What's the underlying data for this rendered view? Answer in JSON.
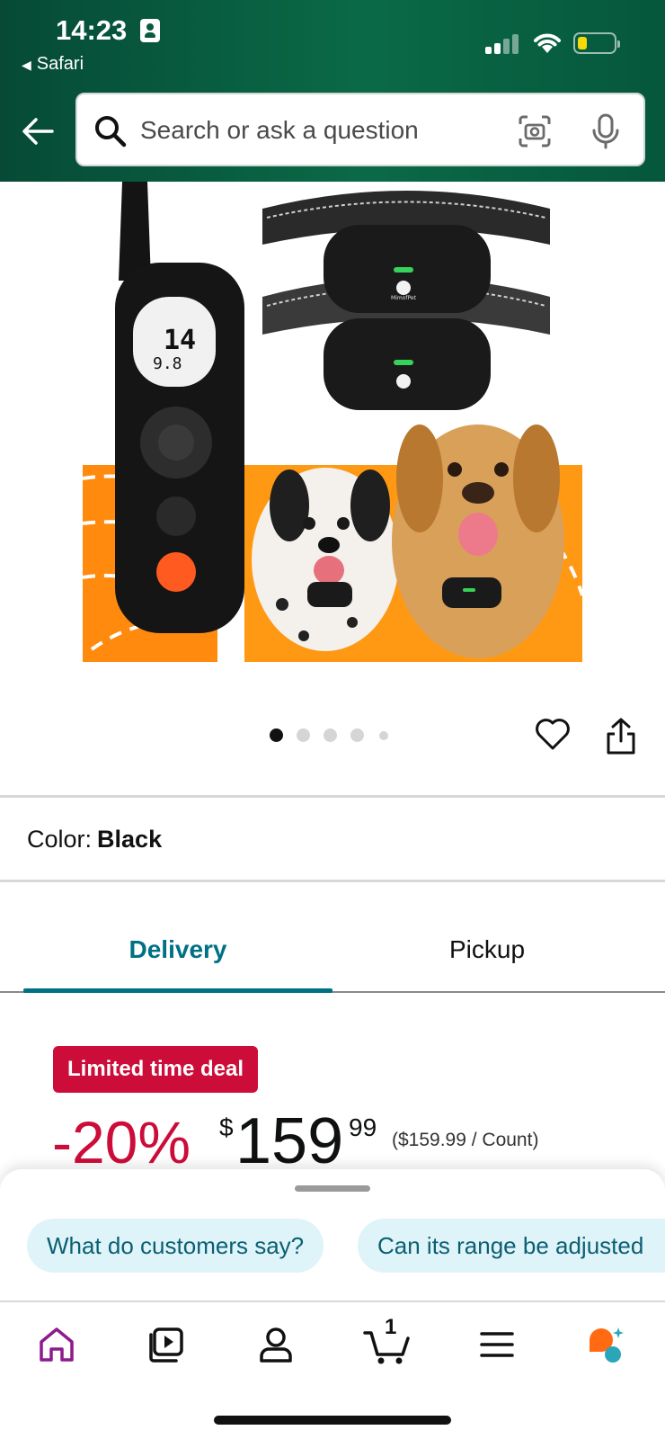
{
  "status_bar": {
    "time": "14:23",
    "back_app": "Safari"
  },
  "search": {
    "placeholder": "Search or ask a question"
  },
  "product": {
    "image_brand": "MimofPet",
    "carousel": {
      "count": 5,
      "active": 1
    },
    "color_label": "Color:",
    "color_value": "Black"
  },
  "tabs": {
    "delivery": "Delivery",
    "pickup": "Pickup",
    "selected": "delivery"
  },
  "deal": {
    "badge": "Limited time deal",
    "discount": "-20%",
    "currency": "$",
    "price_whole": "159",
    "price_fraction": "99",
    "unit_price": "($159.99 / Count)"
  },
  "rufus": {
    "chips": [
      "What do customers say?",
      "Can its range be adjusted"
    ]
  },
  "bottom_nav": {
    "cart_count": "1",
    "items": [
      "home",
      "video",
      "account",
      "cart",
      "menu",
      "rufus"
    ]
  },
  "colors": {
    "header_green": "#0a6a47",
    "link_teal": "#007185",
    "deal_red": "#cc0c39",
    "chip_bg": "#dff4f8"
  }
}
